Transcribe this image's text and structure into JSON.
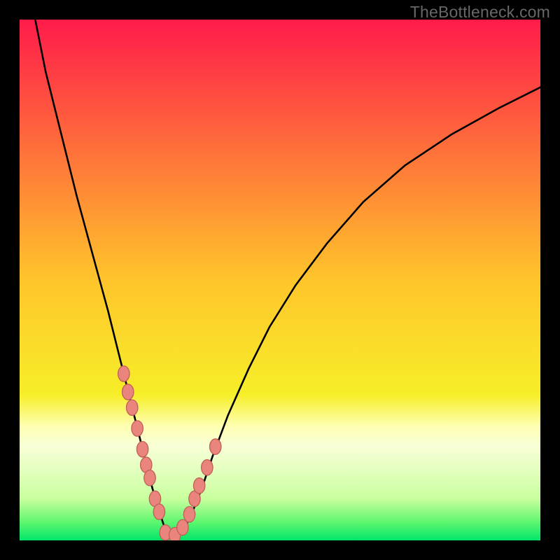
{
  "watermark": "TheBottleneck.com",
  "chart_data": {
    "type": "line",
    "title": "",
    "xlabel": "",
    "ylabel": "",
    "xlim": [
      0,
      100
    ],
    "ylim": [
      0,
      100
    ],
    "background_gradient": {
      "stops": [
        {
          "offset": 0.0,
          "color": "#ff1b4a"
        },
        {
          "offset": 0.5,
          "color": "#ffc52b"
        },
        {
          "offset": 0.72,
          "color": "#f6ee28"
        },
        {
          "offset": 0.78,
          "color": "#feffb1"
        },
        {
          "offset": 0.82,
          "color": "#f8ffd8"
        },
        {
          "offset": 0.92,
          "color": "#c9ff9e"
        },
        {
          "offset": 0.965,
          "color": "#5ef66e"
        },
        {
          "offset": 1.0,
          "color": "#00e66a"
        }
      ]
    },
    "series": [
      {
        "name": "bottleneck-curve",
        "color": "#000000",
        "x": [
          3,
          5,
          8,
          11,
          14,
          17,
          19,
          21,
          22.5,
          24,
          25.5,
          27,
          28,
          29,
          30,
          31.5,
          33,
          35,
          37,
          40,
          44,
          48,
          53,
          59,
          66,
          74,
          83,
          92,
          100
        ],
        "values": [
          100,
          90,
          78,
          66,
          55,
          44,
          36,
          28,
          22,
          16,
          10,
          5,
          2,
          0.5,
          0.5,
          2,
          5,
          10,
          16,
          24,
          33,
          41,
          49,
          57,
          65,
          72,
          78,
          83,
          87
        ]
      }
    ],
    "markers": {
      "name": "highlighted-points",
      "color": "#e9857c",
      "stroke": "#c06158",
      "x": [
        20.0,
        20.8,
        21.6,
        22.6,
        23.6,
        24.3,
        25.0,
        26.0,
        26.8,
        28.0,
        29.8,
        31.3,
        32.6,
        33.6,
        34.5,
        36.0,
        37.6
      ],
      "values": [
        32.0,
        28.5,
        25.5,
        21.5,
        17.5,
        14.5,
        12.0,
        8.0,
        5.5,
        1.5,
        1.0,
        2.5,
        5.0,
        8.0,
        10.5,
        14.0,
        18.0
      ],
      "rx": 1.1,
      "ry": 1.5
    }
  }
}
